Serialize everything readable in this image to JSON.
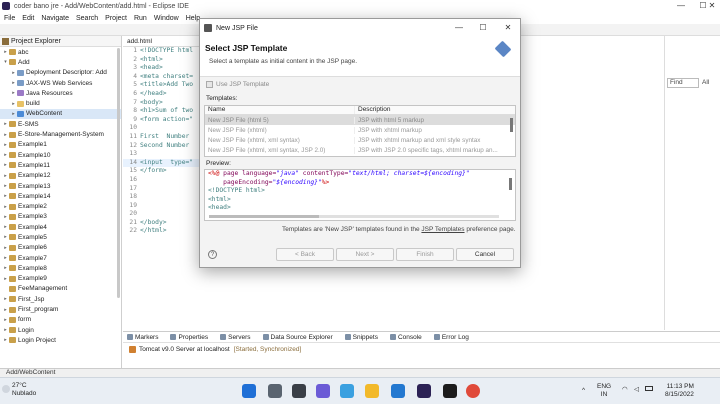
{
  "window": {
    "title": "coder bano jre - Add/WebContent/add.html - Eclipse IDE",
    "controls": {
      "minimize": "—",
      "maximize": "☐",
      "close": "✕"
    }
  },
  "menu": [
    "File",
    "Edit",
    "Navigate",
    "Search",
    "Project",
    "Run",
    "Window",
    "Help"
  ],
  "explorer": {
    "title": "Project Explorer",
    "items": [
      {
        "label": "abc",
        "indent": 0,
        "twisty": "▸",
        "icon": "proj"
      },
      {
        "label": "Add",
        "indent": 0,
        "twisty": "▾",
        "icon": "proj"
      },
      {
        "label": "Deployment Descriptor: Add",
        "indent": 1,
        "twisty": "▸",
        "icon": "desc"
      },
      {
        "label": "JAX-WS Web Services",
        "indent": 1,
        "twisty": "▸",
        "icon": "desc"
      },
      {
        "label": "Java Resources",
        "indent": 1,
        "twisty": "▸",
        "icon": "lib"
      },
      {
        "label": "build",
        "indent": 1,
        "twisty": "▸",
        "icon": "folder"
      },
      {
        "label": "WebContent",
        "indent": 1,
        "twisty": "▸",
        "icon": "web",
        "selected": true
      },
      {
        "label": "E-SMS",
        "indent": 0,
        "twisty": "▸",
        "icon": "proj"
      },
      {
        "label": "E-Store-Management-System",
        "indent": 0,
        "twisty": "▸",
        "icon": "proj"
      },
      {
        "label": "Example1",
        "indent": 0,
        "twisty": "▸",
        "icon": "proj"
      },
      {
        "label": "Example10",
        "indent": 0,
        "twisty": "▸",
        "icon": "proj"
      },
      {
        "label": "Example11",
        "indent": 0,
        "twisty": "▸",
        "icon": "proj"
      },
      {
        "label": "Example12",
        "indent": 0,
        "twisty": "▸",
        "icon": "proj"
      },
      {
        "label": "Example13",
        "indent": 0,
        "twisty": "▸",
        "icon": "proj"
      },
      {
        "label": "Example14",
        "indent": 0,
        "twisty": "▸",
        "icon": "proj"
      },
      {
        "label": "Example2",
        "indent": 0,
        "twisty": "▸",
        "icon": "proj"
      },
      {
        "label": "Example3",
        "indent": 0,
        "twisty": "▸",
        "icon": "proj"
      },
      {
        "label": "Example4",
        "indent": 0,
        "twisty": "▸",
        "icon": "proj"
      },
      {
        "label": "Example5",
        "indent": 0,
        "twisty": "▸",
        "icon": "proj"
      },
      {
        "label": "Example6",
        "indent": 0,
        "twisty": "▸",
        "icon": "proj"
      },
      {
        "label": "Example7",
        "indent": 0,
        "twisty": "▸",
        "icon": "proj"
      },
      {
        "label": "Example8",
        "indent": 0,
        "twisty": "▸",
        "icon": "proj"
      },
      {
        "label": "Example9",
        "indent": 0,
        "twisty": "▸",
        "icon": "proj"
      },
      {
        "label": "FeeManagement",
        "indent": 0,
        "twisty": "",
        "icon": "proj"
      },
      {
        "label": "First_Jsp",
        "indent": 0,
        "twisty": "▸",
        "icon": "proj"
      },
      {
        "label": "First_program",
        "indent": 0,
        "twisty": "▸",
        "icon": "proj"
      },
      {
        "label": "form",
        "indent": 0,
        "twisty": "▸",
        "icon": "proj"
      },
      {
        "label": "Login",
        "indent": 0,
        "twisty": "▸",
        "icon": "proj"
      },
      {
        "label": "Login Project",
        "indent": 0,
        "twisty": "▸",
        "icon": "proj"
      }
    ]
  },
  "editor": {
    "tab": "add.html",
    "lines": [
      {
        "n": "1",
        "text": "<!DOCTYPE html"
      },
      {
        "n": "2",
        "text": "<html>"
      },
      {
        "n": "3",
        "text": "<head>"
      },
      {
        "n": "4",
        "text": "<meta charset="
      },
      {
        "n": "5",
        "text": "<title>Add Two"
      },
      {
        "n": "6",
        "text": "</head>"
      },
      {
        "n": "7",
        "text": "<body>"
      },
      {
        "n": "8",
        "text": "<h1>Sum of two"
      },
      {
        "n": "9",
        "text": "<form action=\""
      },
      {
        "n": "10",
        "text": ""
      },
      {
        "n": "11",
        "text": "First  Number"
      },
      {
        "n": "12",
        "text": "Second Number"
      },
      {
        "n": "13",
        "text": ""
      },
      {
        "n": "14",
        "text": "<input  type=\""
      },
      {
        "n": "15",
        "text": "</form>"
      },
      {
        "n": "16",
        "text": ""
      },
      {
        "n": "17",
        "text": ""
      },
      {
        "n": "18",
        "text": ""
      },
      {
        "n": "19",
        "text": ""
      },
      {
        "n": "20",
        "text": ""
      },
      {
        "n": "21",
        "text": "</body>"
      },
      {
        "n": "22",
        "text": "</html>"
      }
    ]
  },
  "rightpane": {
    "find_placeholder": "Find",
    "all_label": "All",
    "more": "▸"
  },
  "dialog": {
    "title": "New JSP File",
    "heading": "Select JSP Template",
    "subheading": "Select a template as initial content in the JSP page.",
    "use_template_label": "Use JSP Template",
    "templates_label": "Templates:",
    "columns": [
      "Name",
      "Description"
    ],
    "templates": [
      {
        "name": "New JSP File (html 5)",
        "desc": "JSP with html 5 markup",
        "selected": true
      },
      {
        "name": "New JSP File (xhtml)",
        "desc": "JSP with xhtml markup",
        "selected": false
      },
      {
        "name": "New JSP File (xhtml, xml syntax)",
        "desc": "JSP with xhtml markup and xml style syntax",
        "selected": false
      },
      {
        "name": "New JSP File (xhtml, xml syntax, JSP 2.0)",
        "desc": "JSP with JSP 2.0 specific tags, xhtml markup an...",
        "selected": false
      }
    ],
    "preview_label": "Preview:",
    "preview_lines": [
      {
        "a": "<%@ ",
        "b": "page language=",
        "c": "\"java\"",
        "d": " contentType=",
        "e": "\"text/html; charset=${encoding}\""
      },
      {
        "a": "    ",
        "b": "pageEncoding=",
        "c": "\"${encoding}\"",
        "d": "%>",
        "e": ""
      },
      {
        "a": "",
        "b": "<!DOCTYPE html>",
        "c": "",
        "d": "",
        "e": ""
      },
      {
        "a": "",
        "b": "<html>",
        "c": "",
        "d": "",
        "e": ""
      },
      {
        "a": "",
        "b": "<head>",
        "c": "",
        "d": "",
        "e": ""
      }
    ],
    "info_prefix": "Templates are 'New JSP' templates found in the ",
    "info_link": "JSP Templates",
    "info_suffix": " preference page.",
    "buttons": {
      "help": "?",
      "back": "< Back",
      "next": "Next >",
      "finish": "Finish",
      "cancel": "Cancel"
    }
  },
  "bottom": {
    "tabs": [
      "Markers",
      "Properties",
      "Servers",
      "Data Source Explorer",
      "Snippets",
      "Console",
      "Error Log"
    ],
    "server_name": "Tomcat v9.0 Server at localhost",
    "server_status": "[Started, Synchronized]"
  },
  "statusbar": {
    "text": "Add/WebContent"
  },
  "taskbar": {
    "weather_temp": "27°C",
    "weather_desc": "Nublado",
    "lang_top": "ENG",
    "lang_bottom": "IN",
    "time": "11:13 PM",
    "date": "8/15/2022",
    "overflow": "^"
  }
}
